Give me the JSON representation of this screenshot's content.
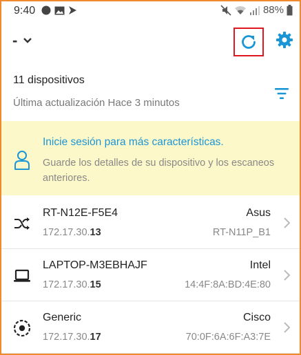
{
  "status_bar": {
    "time": "9:40",
    "battery": "88%"
  },
  "app_bar": {
    "network_name": "-"
  },
  "summary": {
    "device_count": "11 dispositivos",
    "last_update": "Última actualización Hace 3 minutos"
  },
  "banner": {
    "title": "Inicie sesión para más características.",
    "body": "Guarde los detalles de su dispositivo y los escaneos anteriores."
  },
  "devices": [
    {
      "name": "RT-N12E-F5E4",
      "ip_prefix": "172.17.30.",
      "ip_suffix": "13",
      "vendor": "Asus",
      "detail": "RT-N11P_B1",
      "icon": "router-shuffle-icon"
    },
    {
      "name": "LAPTOP-M3EBHAJF",
      "ip_prefix": "172.17.30.",
      "ip_suffix": "15",
      "vendor": "Intel",
      "detail": "14:4F:8A:BD:4E:80",
      "icon": "laptop-icon"
    },
    {
      "name": "Generic",
      "ip_prefix": "172.17.30.",
      "ip_suffix": "17",
      "vendor": "Cisco",
      "detail": "70:0F:6A:6F:A3:7E",
      "icon": "generic-device-icon"
    }
  ],
  "colors": {
    "accent": "#1a96d6",
    "banner_bg": "#fdf8c9",
    "highlight_border": "#e0161f"
  }
}
